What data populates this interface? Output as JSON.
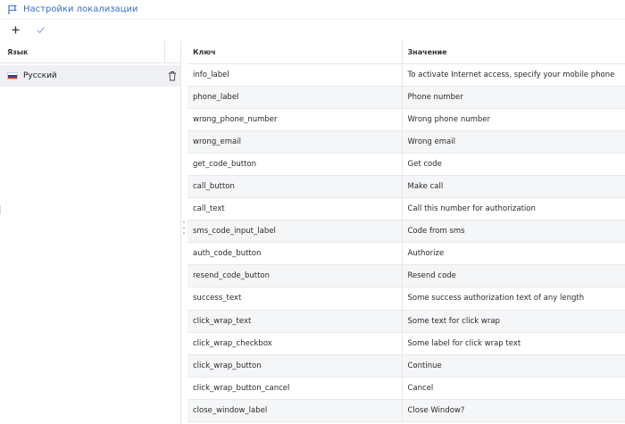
{
  "header": {
    "title": "Настройки локализации",
    "icon": "flag-outline-icon",
    "accent": "#3a6fd1"
  },
  "toolbar": {
    "add_icon": "plus-icon",
    "confirm_icon": "check-icon"
  },
  "languages": {
    "column_header": "Язык",
    "items": [
      {
        "label": "Русский",
        "flag": "ru-flag-icon",
        "delete_icon": "trash-icon"
      }
    ]
  },
  "table": {
    "columns": [
      "Ключ",
      "Значение"
    ],
    "rows": [
      {
        "key": "info_label",
        "value": "To activate Internet access, specify your mobile phone"
      },
      {
        "key": "phone_label",
        "value": "Phone number"
      },
      {
        "key": "wrong_phone_number",
        "value": "Wrong phone number"
      },
      {
        "key": "wrong_email",
        "value": "Wrong email"
      },
      {
        "key": "get_code_button",
        "value": "Get code"
      },
      {
        "key": "call_button",
        "value": "Make call"
      },
      {
        "key": "call_text",
        "value": "Call this number for authorization"
      },
      {
        "key": "sms_code_input_label",
        "value": "Code from sms"
      },
      {
        "key": "auth_code_button",
        "value": "Authorize"
      },
      {
        "key": "resend_code_button",
        "value": "Resend code"
      },
      {
        "key": "success_text",
        "value": "Some success authorization text of any length"
      },
      {
        "key": "click_wrap_text",
        "value": "Some text for click wrap"
      },
      {
        "key": "click_wrap_checkbox",
        "value": "Some label for click wrap text"
      },
      {
        "key": "click_wrap_button",
        "value": "Continue"
      },
      {
        "key": "click_wrap_button_cancel",
        "value": "Cancel"
      },
      {
        "key": "close_window_label",
        "value": "Close Window?"
      }
    ]
  }
}
